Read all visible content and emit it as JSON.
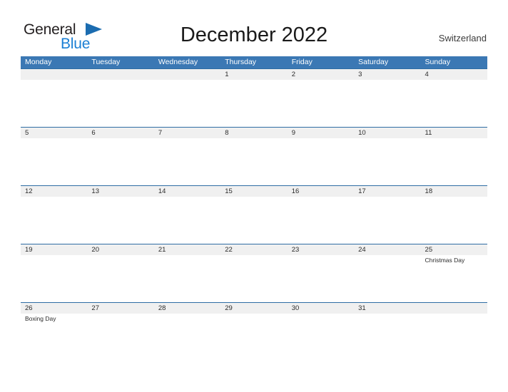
{
  "brand": {
    "word_one": "General",
    "word_two": "Blue",
    "triangle_icon": "blue-triangle-icon",
    "accent_color": "#1b7fd4"
  },
  "header": {
    "title": "December 2022",
    "country": "Switzerland"
  },
  "theme": {
    "header_blue": "#3b78b4",
    "rule_blue": "#2e6da4",
    "date_stripe_gray": "#f0f0f0",
    "text_dark": "#2b2b2b"
  },
  "calendar": {
    "weekdays": [
      "Monday",
      "Tuesday",
      "Wednesday",
      "Thursday",
      "Friday",
      "Saturday",
      "Sunday"
    ],
    "weeks": [
      {
        "days": [
          {
            "date": "",
            "event": ""
          },
          {
            "date": "",
            "event": ""
          },
          {
            "date": "",
            "event": ""
          },
          {
            "date": "1",
            "event": ""
          },
          {
            "date": "2",
            "event": ""
          },
          {
            "date": "3",
            "event": ""
          },
          {
            "date": "4",
            "event": ""
          }
        ]
      },
      {
        "days": [
          {
            "date": "5",
            "event": ""
          },
          {
            "date": "6",
            "event": ""
          },
          {
            "date": "7",
            "event": ""
          },
          {
            "date": "8",
            "event": ""
          },
          {
            "date": "9",
            "event": ""
          },
          {
            "date": "10",
            "event": ""
          },
          {
            "date": "11",
            "event": ""
          }
        ]
      },
      {
        "days": [
          {
            "date": "12",
            "event": ""
          },
          {
            "date": "13",
            "event": ""
          },
          {
            "date": "14",
            "event": ""
          },
          {
            "date": "15",
            "event": ""
          },
          {
            "date": "16",
            "event": ""
          },
          {
            "date": "17",
            "event": ""
          },
          {
            "date": "18",
            "event": ""
          }
        ]
      },
      {
        "days": [
          {
            "date": "19",
            "event": ""
          },
          {
            "date": "20",
            "event": ""
          },
          {
            "date": "21",
            "event": ""
          },
          {
            "date": "22",
            "event": ""
          },
          {
            "date": "23",
            "event": ""
          },
          {
            "date": "24",
            "event": ""
          },
          {
            "date": "25",
            "event": "Christmas Day"
          }
        ]
      },
      {
        "days": [
          {
            "date": "26",
            "event": "Boxing Day"
          },
          {
            "date": "27",
            "event": ""
          },
          {
            "date": "28",
            "event": ""
          },
          {
            "date": "29",
            "event": ""
          },
          {
            "date": "30",
            "event": ""
          },
          {
            "date": "31",
            "event": ""
          },
          {
            "date": "",
            "event": ""
          }
        ]
      }
    ]
  }
}
